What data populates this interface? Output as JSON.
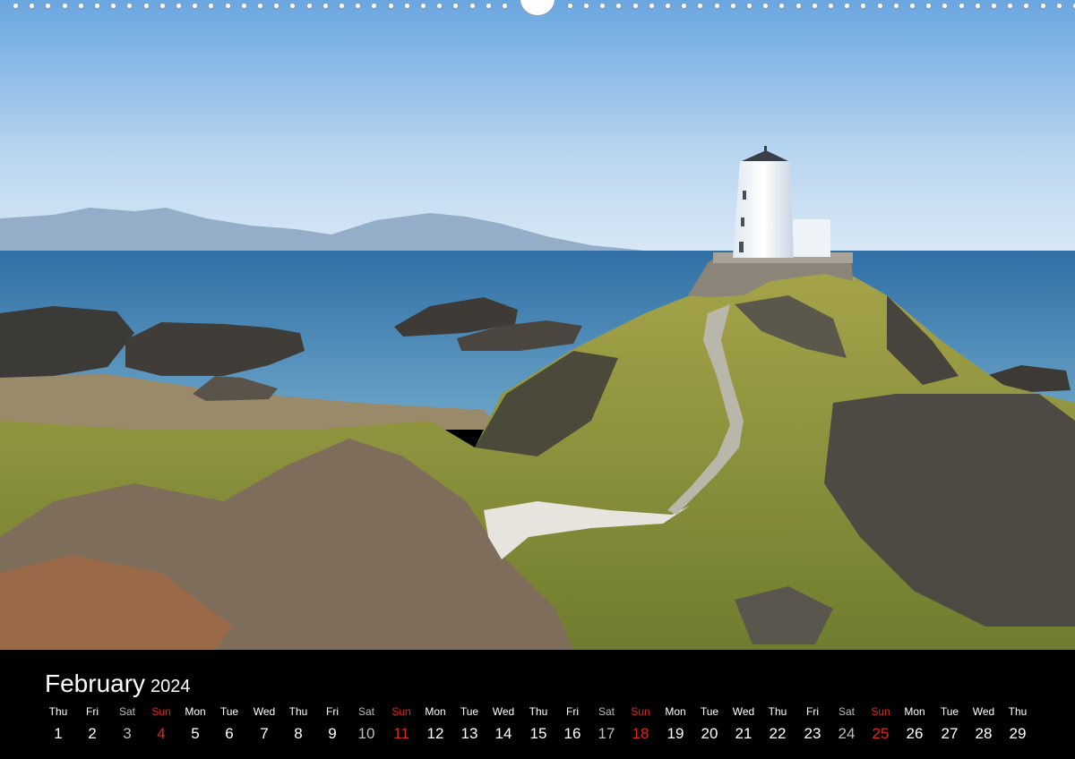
{
  "calendar": {
    "month": "February",
    "year": "2024",
    "days": [
      {
        "name": "Thu",
        "num": "1",
        "type": "weekday"
      },
      {
        "name": "Fri",
        "num": "2",
        "type": "weekday"
      },
      {
        "name": "Sat",
        "num": "3",
        "type": "sat"
      },
      {
        "name": "Sun",
        "num": "4",
        "type": "sun"
      },
      {
        "name": "Mon",
        "num": "5",
        "type": "weekday"
      },
      {
        "name": "Tue",
        "num": "6",
        "type": "weekday"
      },
      {
        "name": "Wed",
        "num": "7",
        "type": "weekday"
      },
      {
        "name": "Thu",
        "num": "8",
        "type": "weekday"
      },
      {
        "name": "Fri",
        "num": "9",
        "type": "weekday"
      },
      {
        "name": "Sat",
        "num": "10",
        "type": "sat"
      },
      {
        "name": "Sun",
        "num": "11",
        "type": "sun"
      },
      {
        "name": "Mon",
        "num": "12",
        "type": "weekday"
      },
      {
        "name": "Tue",
        "num": "13",
        "type": "weekday"
      },
      {
        "name": "Wed",
        "num": "14",
        "type": "weekday"
      },
      {
        "name": "Thu",
        "num": "15",
        "type": "weekday"
      },
      {
        "name": "Fri",
        "num": "16",
        "type": "weekday"
      },
      {
        "name": "Sat",
        "num": "17",
        "type": "sat"
      },
      {
        "name": "Sun",
        "num": "18",
        "type": "sun"
      },
      {
        "name": "Mon",
        "num": "19",
        "type": "weekday"
      },
      {
        "name": "Tue",
        "num": "20",
        "type": "weekday"
      },
      {
        "name": "Wed",
        "num": "21",
        "type": "weekday"
      },
      {
        "name": "Thu",
        "num": "22",
        "type": "weekday"
      },
      {
        "name": "Fri",
        "num": "23",
        "type": "weekday"
      },
      {
        "name": "Sat",
        "num": "24",
        "type": "sat"
      },
      {
        "name": "Sun",
        "num": "25",
        "type": "sun"
      },
      {
        "name": "Mon",
        "num": "26",
        "type": "weekday"
      },
      {
        "name": "Tue",
        "num": "27",
        "type": "weekday"
      },
      {
        "name": "Wed",
        "num": "28",
        "type": "weekday"
      },
      {
        "name": "Thu",
        "num": "29",
        "type": "weekday"
      }
    ]
  },
  "colors": {
    "sunday": "#e0281e",
    "saturday": "#bdbdbd",
    "background": "#000000"
  }
}
